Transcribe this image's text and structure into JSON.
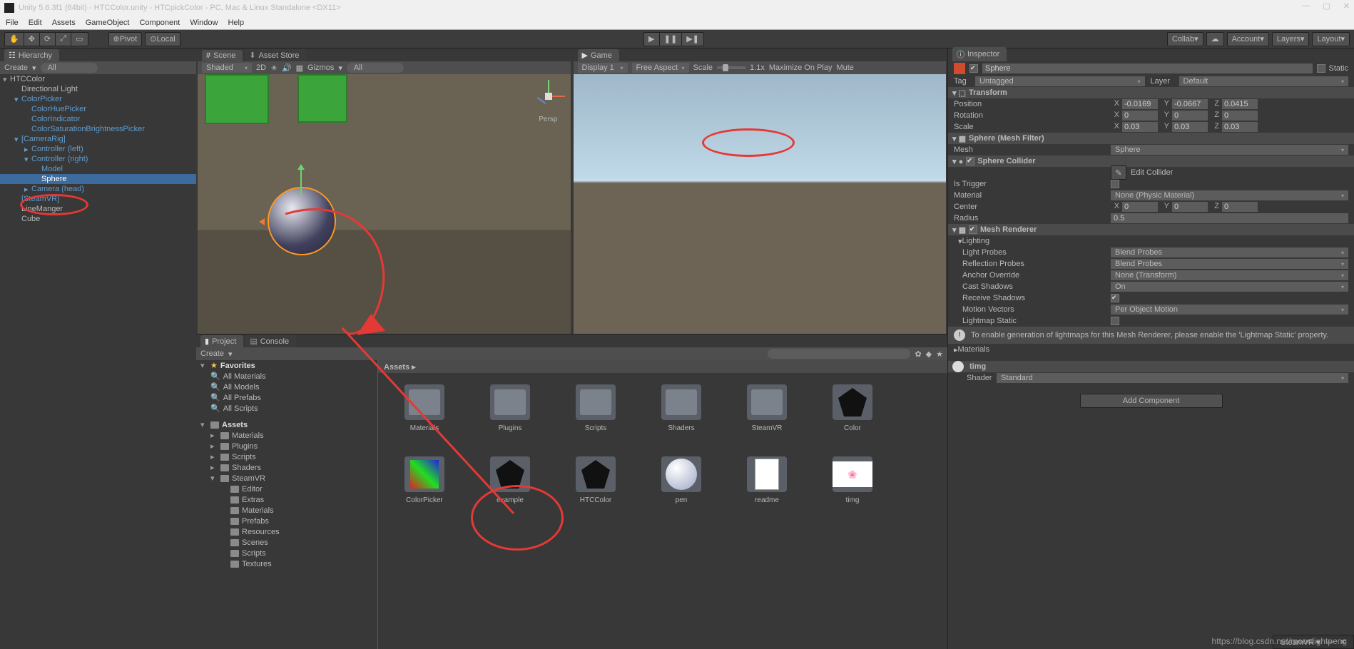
{
  "titlebar": {
    "text": "Unity 5.6.3f1 (64bit) - HTCColor.unity - HTCpickColor - PC, Mac & Linux Standalone <DX11>",
    "min": "—",
    "max": "▢",
    "close": "✕"
  },
  "menus": [
    "File",
    "Edit",
    "Assets",
    "GameObject",
    "Component",
    "Window",
    "Help"
  ],
  "toolbar": {
    "pivot": "Pivot",
    "local": "Local",
    "collab": "Collab",
    "account": "Account",
    "layers": "Layers",
    "layout": "Layout"
  },
  "hierarchy": {
    "tab": "Hierarchy",
    "create": "Create",
    "allSearch": "All",
    "items": [
      {
        "lvl": 0,
        "text": "HTCColor",
        "fold": "▾",
        "cls": ""
      },
      {
        "lvl": 1,
        "text": "Directional Light",
        "cls": ""
      },
      {
        "lvl": 1,
        "text": "ColorPicker",
        "fold": "▾",
        "cls": "blue"
      },
      {
        "lvl": 2,
        "text": "ColorHuePicker",
        "cls": "blue"
      },
      {
        "lvl": 2,
        "text": "ColorIndicator",
        "cls": "blue"
      },
      {
        "lvl": 2,
        "text": "ColorSaturationBrightnessPicker",
        "cls": "blue"
      },
      {
        "lvl": 1,
        "text": "[CameraRig]",
        "fold": "▾",
        "cls": "blue"
      },
      {
        "lvl": 2,
        "text": "Controller (left)",
        "fold": "▸",
        "cls": "blue"
      },
      {
        "lvl": 2,
        "text": "Controller (right)",
        "fold": "▾",
        "cls": "blue"
      },
      {
        "lvl": 3,
        "text": "Model",
        "cls": "blue"
      },
      {
        "lvl": 3,
        "text": "Sphere",
        "cls": "sel"
      },
      {
        "lvl": 2,
        "text": "Camera (head)",
        "fold": "▸",
        "cls": "blue"
      },
      {
        "lvl": 1,
        "text": "[SteamVR]",
        "cls": "blue"
      },
      {
        "lvl": 1,
        "text": "LineManger",
        "cls": ""
      },
      {
        "lvl": 1,
        "text": "Cube",
        "cls": ""
      }
    ]
  },
  "scene": {
    "tab": "Scene",
    "assetstore": "Asset Store",
    "shaded": "Shaded",
    "twod": "2D",
    "gizmos": "Gizmos",
    "allSearch": "All",
    "persp": "Persp"
  },
  "game": {
    "tab": "Game",
    "display": "Display 1",
    "aspect": "Free Aspect",
    "scale": "Scale",
    "scaleVal": "1.1x",
    "max": "Maximize On Play",
    "mute": "Mute"
  },
  "project": {
    "tab": "Project",
    "console": "Console",
    "create": "Create",
    "favorites": "Favorites",
    "favs": [
      "All Materials",
      "All Models",
      "All Prefabs",
      "All Scripts"
    ],
    "assets": "Assets",
    "tree": [
      "Materials",
      "Plugins",
      "Scripts",
      "Shaders",
      "SteamVR"
    ],
    "svr": [
      "Editor",
      "Extras",
      "Materials",
      "Prefabs",
      "Resources",
      "Scenes",
      "Scripts",
      "Textures"
    ],
    "breadcrumb": "Assets ▸",
    "grid": [
      "Materials",
      "Plugins",
      "Scripts",
      "Shaders",
      "SteamVR",
      "Color",
      "ColorPicker",
      "example",
      "HTCColor",
      "pen",
      "readme",
      "timg"
    ]
  },
  "inspector": {
    "tab": "Inspector",
    "static": "Static",
    "name": "Sphere",
    "tag": "Tag",
    "tagVal": "Untagged",
    "layer": "Layer",
    "layerVal": "Default",
    "transform": "Transform",
    "pos": "Position",
    "rot": "Rotation",
    "scl": "Scale",
    "px": "-0.0169",
    "py": "-0.0667",
    "pz": "0.0415",
    "rx": "0",
    "ry": "0",
    "rz": "0",
    "sx": "0.03",
    "sy": "0.03",
    "sz": "0.03",
    "meshFilter": "Sphere (Mesh Filter)",
    "mesh": "Mesh",
    "meshVal": "Sphere",
    "collider": "Sphere Collider",
    "editColl": "Edit Collider",
    "isTrigger": "Is Trigger",
    "material": "Material",
    "matVal": "None (Physic Material)",
    "center": "Center",
    "cx": "0",
    "cy": "0",
    "cz": "0",
    "radius": "Radius",
    "radVal": "0.5",
    "meshRend": "Mesh Renderer",
    "lighting": "Lighting",
    "lightProbes": "Light Probes",
    "lpVal": "Blend Probes",
    "reflProbes": "Reflection Probes",
    "rpVal": "Blend Probes",
    "anchor": "Anchor Override",
    "anchorVal": "None (Transform)",
    "castShadow": "Cast Shadows",
    "csVal": "On",
    "recvShadow": "Receive Shadows",
    "motionVec": "Motion Vectors",
    "mvVal": "Per Object Motion",
    "lmStatic": "Lightmap Static",
    "lmInfo": "To enable generation of lightmaps for this Mesh Renderer, please enable the 'Lightmap Static' property.",
    "materials": "Materials",
    "timg": "timg",
    "shader": "Shader",
    "shaderVal": "Standard",
    "addComponent": "Add Component"
  },
  "statusbar": {
    "steamvr": "SteamVR ▾",
    "min": "—",
    "close": "✕"
  },
  "watermark": "https://blog.csdn.net/moonlightpeng"
}
